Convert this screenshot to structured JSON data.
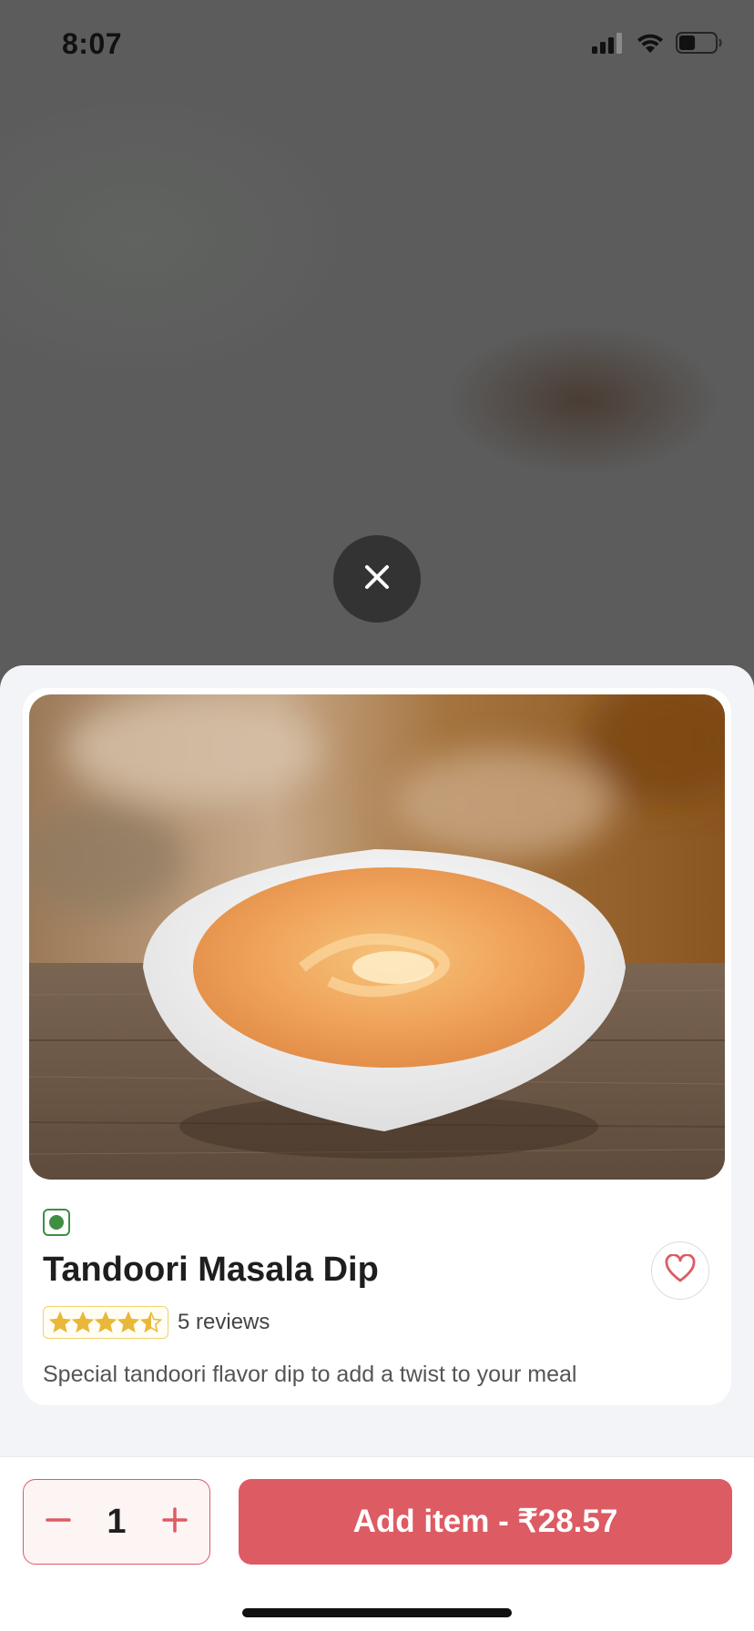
{
  "status_bar": {
    "time": "8:07",
    "icons": [
      "cellular-signal-icon",
      "wifi-icon",
      "battery-icon"
    ],
    "battery_level": 0.45
  },
  "close_icon": "close-icon",
  "product": {
    "image_description_icon": "food-photo",
    "veg_icon": "veg-indicator-icon",
    "veg_color": "#3f8f43",
    "title": "Tandoori Masala Dip",
    "rating": 4.5,
    "rating_max": 5,
    "reviews_label": "5 reviews",
    "description": "Special tandoori flavor dip to add a twist to your meal",
    "favorite_icon": "heart-icon"
  },
  "cart": {
    "quantity": "1",
    "decrement_icon": "minus-icon",
    "increment_icon": "plus-icon",
    "add_button_label": "Add item - ₹28.57"
  },
  "colors": {
    "accent": "#dd5b63",
    "star": "#e9b83a",
    "text_primary": "#1e1e1e"
  }
}
